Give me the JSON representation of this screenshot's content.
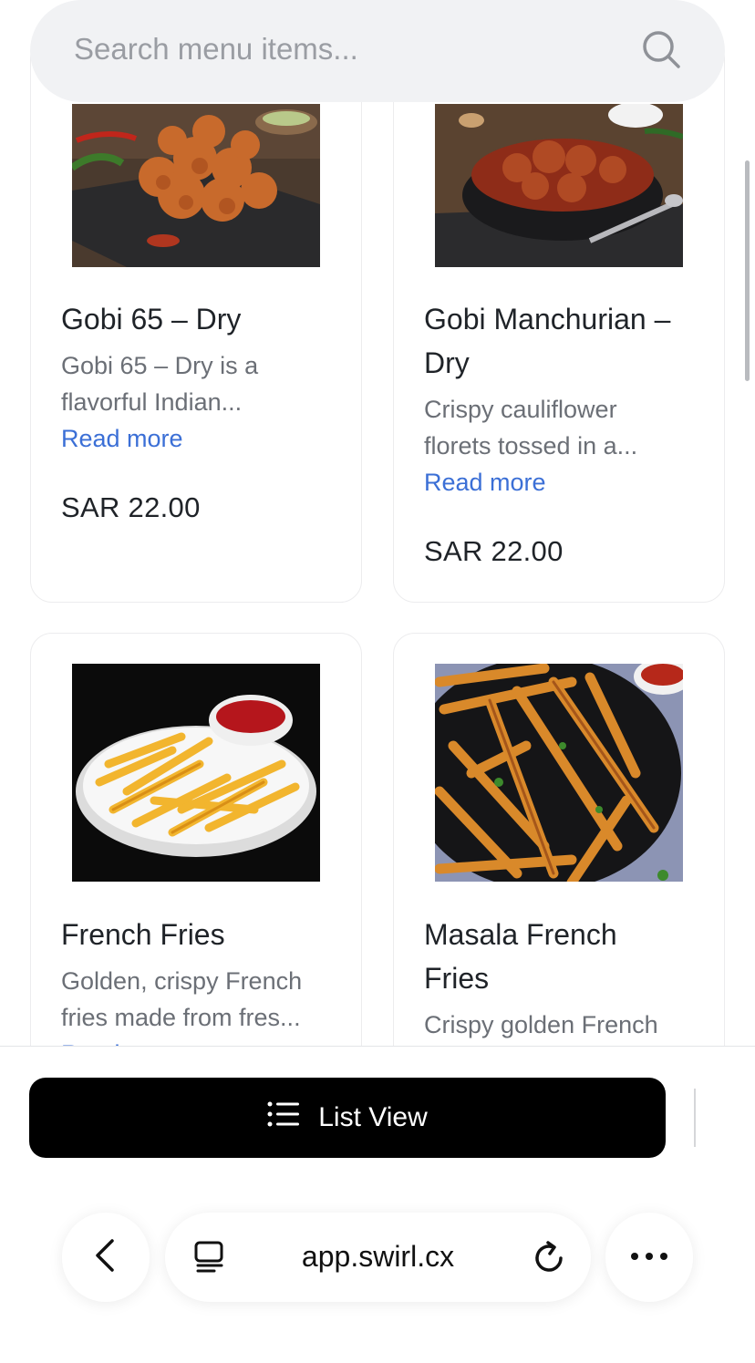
{
  "search": {
    "placeholder": "Search menu items..."
  },
  "items": [
    {
      "title": "Gobi 65 – Dry",
      "description": "Gobi 65 – Dry is a flavorful Indian...",
      "read_more": "Read more",
      "price": "SAR 22.00"
    },
    {
      "title": "Gobi Manchurian – Dry",
      "description": "Crispy cauliflower florets tossed in a...",
      "read_more": "Read more",
      "price": "SAR 22.00"
    },
    {
      "title": "French Fries",
      "description": "Golden, crispy French fries made from fres...",
      "read_more": "Read more",
      "price": ""
    },
    {
      "title": "Masala French Fries",
      "description": "Crispy golden French",
      "read_more": "",
      "price": ""
    }
  ],
  "action": {
    "list_view_label": "List View"
  },
  "browser": {
    "url": "app.swirl.cx"
  },
  "colors": {
    "link": "#3b6fd6",
    "button_bg": "#000000",
    "search_bg": "#f1f2f4"
  },
  "icons": [
    "search-icon",
    "list-icon",
    "back-icon",
    "tabs-icon",
    "reload-icon",
    "more-icon"
  ]
}
